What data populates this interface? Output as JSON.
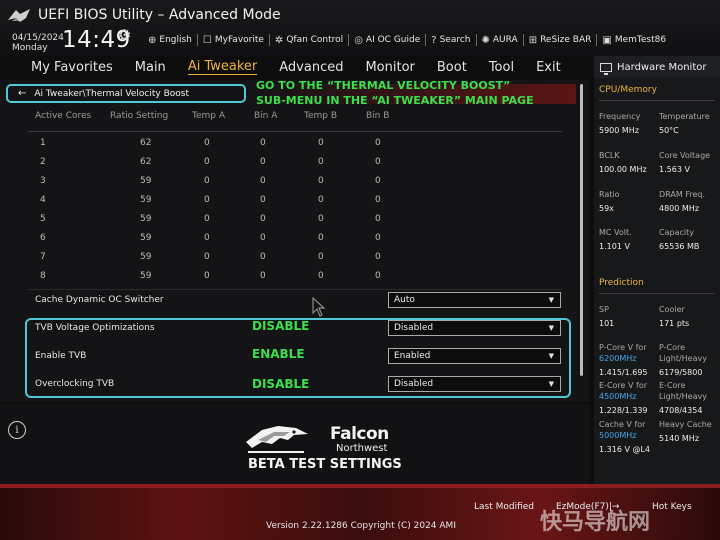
{
  "header": {
    "title": "UEFI BIOS Utility – Advanced Mode",
    "date": "04/15/2024",
    "day": "Monday",
    "time": "14:49",
    "toolbar": [
      {
        "icon": "globe-icon",
        "glyph": "⊕",
        "label": "English"
      },
      {
        "icon": "favorite-icon",
        "glyph": "☐",
        "label": "MyFavorite"
      },
      {
        "icon": "fan-icon",
        "glyph": "✲",
        "label": "Qfan Control"
      },
      {
        "icon": "ai-oc-icon",
        "glyph": "◎",
        "label": "AI OC Guide"
      },
      {
        "icon": "search-icon",
        "glyph": "?",
        "label": "Search"
      },
      {
        "icon": "aura-icon",
        "glyph": "✺",
        "label": "AURA"
      },
      {
        "icon": "resize-bar-icon",
        "glyph": "⊞",
        "label": "ReSize BAR"
      },
      {
        "icon": "memtest-icon",
        "glyph": "▣",
        "label": "MemTest86"
      }
    ]
  },
  "nav": {
    "tabs": [
      "My Favorites",
      "Main",
      "Ai Tweaker",
      "Advanced",
      "Monitor",
      "Boot",
      "Tool",
      "Exit"
    ],
    "active_index": 2
  },
  "breadcrumb": "Ai Tweaker\\Thermal Velocity Boost",
  "annotations": {
    "line1": "GO TO THE “THERMAL VELOCITY BOOST”",
    "line2": "SUB-MENU IN THE “AI TWEAKER” MAIN PAGE",
    "tvb_voltage": "DISABLE",
    "enable_tvb": "ENABLE",
    "overclocking_tvb": "DISABLE"
  },
  "table": {
    "headers": [
      "Active Cores",
      "Ratio Setting",
      "Temp A",
      "Bin A",
      "Temp B",
      "Bin B"
    ],
    "rows": [
      [
        "1",
        "62",
        "0",
        "0",
        "0",
        "0"
      ],
      [
        "2",
        "62",
        "0",
        "0",
        "0",
        "0"
      ],
      [
        "3",
        "59",
        "0",
        "0",
        "0",
        "0"
      ],
      [
        "4",
        "59",
        "0",
        "0",
        "0",
        "0"
      ],
      [
        "5",
        "59",
        "0",
        "0",
        "0",
        "0"
      ],
      [
        "6",
        "59",
        "0",
        "0",
        "0",
        "0"
      ],
      [
        "7",
        "59",
        "0",
        "0",
        "0",
        "0"
      ],
      [
        "8",
        "59",
        "0",
        "0",
        "0",
        "0"
      ]
    ]
  },
  "settings": {
    "cache_dynamic": {
      "label": "Cache Dynamic OC Switcher",
      "value": "Auto"
    },
    "tvb_voltage": {
      "label": "TVB Voltage Optimizations",
      "value": "Disabled"
    },
    "enable_tvb": {
      "label": "Enable TVB",
      "value": "Enabled"
    },
    "overclocking_tvb": {
      "label": "Overclocking TVB",
      "value": "Disabled"
    }
  },
  "hardware_monitor": {
    "title": "Hardware Monitor",
    "cpu_memory_title": "CPU/Memory",
    "frequency_label": "Frequency",
    "frequency_value": "5900 MHz",
    "temperature_label": "Temperature",
    "temperature_value": "50°C",
    "bclk_label": "BCLK",
    "bclk_value": "100.00 MHz",
    "core_voltage_label": "Core Voltage",
    "core_voltage_value": "1.563 V",
    "ratio_label": "Ratio",
    "ratio_value": "59x",
    "dram_freq_label": "DRAM Freq.",
    "dram_freq_value": "4800 MHz",
    "mc_volt_label": "MC Volt.",
    "mc_volt_value": "1.101 V",
    "capacity_label": "Capacity",
    "capacity_value": "65536 MB",
    "prediction_title": "Prediction",
    "sp_label": "SP",
    "sp_value": "101",
    "cooler_label": "Cooler",
    "cooler_value": "171 pts",
    "pcore_v_label": "P-Core V for",
    "pcore_v_freq": "6200MHz",
    "pcore_v_value": "1.415/1.695",
    "pcore_lh_label1": "P-Core",
    "pcore_lh_label2": "Light/Heavy",
    "pcore_lh_value": "6179/5800",
    "ecore_v_label": "E-Core V for",
    "ecore_v_freq": "4500MHz",
    "ecore_v_value": "1.228/1.339",
    "ecore_lh_label1": "E-Core",
    "ecore_lh_label2": "Light/Heavy",
    "ecore_lh_value": "4708/4354",
    "cache_v_label": "Cache V for",
    "cache_v_freq": "5000MHz",
    "cache_v_value": "1.316 V @L4",
    "heavy_cache_label": "Heavy Cache",
    "heavy_cache_value": "5140 MHz"
  },
  "branding": {
    "name": "Falcon",
    "subname": "Northwest",
    "banner": "BETA TEST SETTINGS"
  },
  "footer": {
    "last_modified": "Last Modified",
    "ezmode": "EzMode(F7)|→",
    "hotkeys": "Hot Keys",
    "version": "Version 2.22.1286 Copyright (C) 2024 AMI",
    "watermark": "快马导航网"
  },
  "colors": {
    "accent": "#f0b43a",
    "highlight_box": "#4ec7d6",
    "annotation_text": "#3ae04a",
    "monitor_blue": "#43a6e8"
  }
}
